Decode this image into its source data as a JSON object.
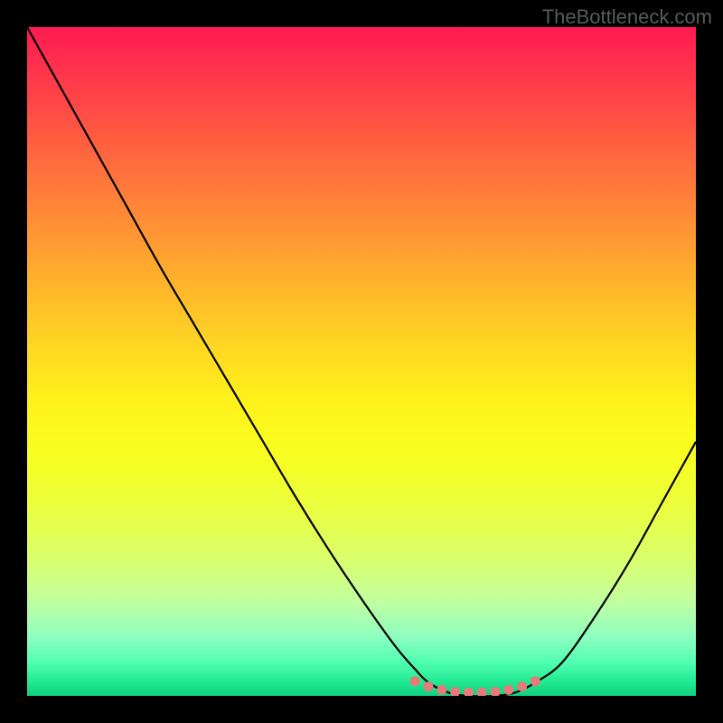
{
  "attribution": "TheBottleneck.com",
  "chart_data": {
    "type": "line",
    "title": "",
    "xlabel": "",
    "ylabel": "",
    "xlim": [
      0,
      100
    ],
    "ylim": [
      0,
      100
    ],
    "series": [
      {
        "name": "bottleneck-curve",
        "x": [
          0,
          5,
          10,
          15,
          20,
          25,
          30,
          35,
          40,
          45,
          50,
          55,
          58,
          60,
          63,
          66,
          70,
          73,
          76,
          80,
          85,
          90,
          95,
          100
        ],
        "values": [
          100,
          91,
          82,
          73,
          64,
          55.5,
          47,
          38.5,
          30,
          22,
          14.5,
          7.5,
          4,
          2,
          0.5,
          0,
          0,
          0.5,
          2,
          5,
          12,
          20,
          29,
          38
        ]
      }
    ],
    "markers": {
      "name": "flat-region-dots",
      "color": "#e87a7a",
      "x": [
        58,
        60,
        62,
        64,
        66,
        68,
        70,
        72,
        74,
        76
      ],
      "y": [
        2.2,
        1.4,
        0.9,
        0.6,
        0.5,
        0.5,
        0.6,
        0.9,
        1.4,
        2.2
      ]
    },
    "gradient_stops": [
      {
        "pos": 0,
        "color": "#ff1a52"
      },
      {
        "pos": 50,
        "color": "#ffe020"
      },
      {
        "pos": 100,
        "color": "#10d080"
      }
    ]
  }
}
